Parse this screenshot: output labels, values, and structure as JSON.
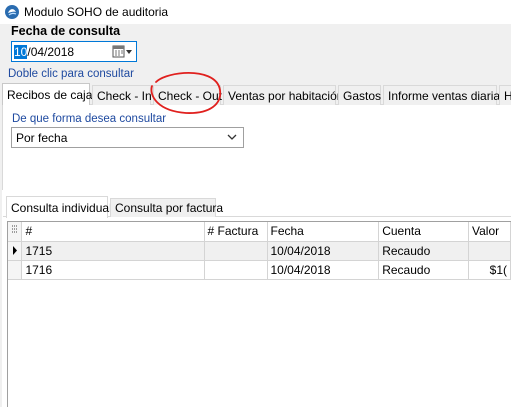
{
  "window": {
    "title": "Modulo SOHO de auditoria"
  },
  "fecha": {
    "label": "Fecha de consulta",
    "date_selected": "10",
    "date_rest": "/04/2018"
  },
  "hint": "Doble clic para consultar",
  "tabs": [
    {
      "label": "Recibos de caja"
    },
    {
      "label": "Check - In"
    },
    {
      "label": "Check - Out"
    },
    {
      "label": "Ventas por habitación"
    },
    {
      "label": "Gastos"
    },
    {
      "label": "Informe ventas diarias"
    },
    {
      "label": "H"
    }
  ],
  "consulta": {
    "label": "De que forma desea consultar",
    "selected": "Por fecha"
  },
  "subtabs": [
    {
      "label": "Consulta individual"
    },
    {
      "label": "Consulta por factura"
    }
  ],
  "table": {
    "columns": [
      "#",
      "# Factura",
      "Fecha",
      "Cuenta",
      "Valor"
    ],
    "rows": [
      {
        "num": "1715",
        "factura": "",
        "fecha": "10/04/2018",
        "cuenta": "Recaudo",
        "valor": ""
      },
      {
        "num": "1716",
        "factura": "",
        "fecha": "10/04/2018",
        "cuenta": "Recaudo",
        "valor": "$1("
      }
    ]
  },
  "colors": {
    "accent": "#0078d7",
    "hint_text": "#1f4aa0",
    "annotation": "#e0201e"
  }
}
